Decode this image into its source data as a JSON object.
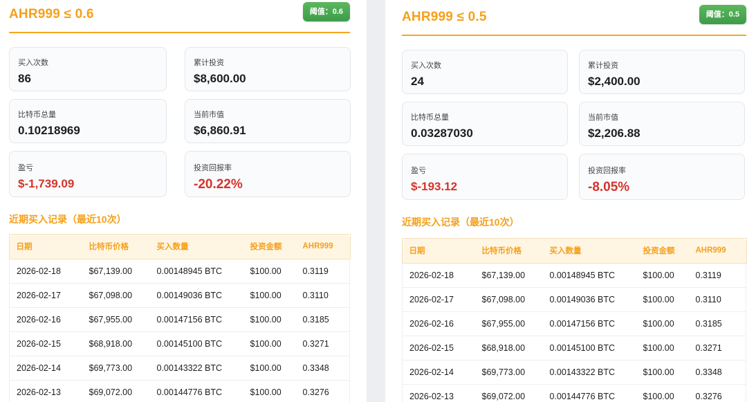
{
  "panels": [
    {
      "title": "AHR999 ≤ 0.6",
      "badge": "阈值：0.6",
      "stats": [
        {
          "label": "买入次数",
          "value": "86"
        },
        {
          "label": "累计投资",
          "value": "$8,600.00"
        },
        {
          "label": "比特币总量",
          "value": "0.10218969"
        },
        {
          "label": "当前市值",
          "value": "$6,860.91"
        },
        {
          "label": "盈亏",
          "value": "$-1,739.09"
        },
        {
          "label": "投资回报率",
          "value": "-20.22%"
        }
      ],
      "section_title": "近期买入记录（最近10次）",
      "table": {
        "headers": [
          "日期",
          "比特币价格",
          "买入数量",
          "投资金额",
          "AHR999"
        ],
        "rows": [
          [
            "2026-02-18",
            "$67,139.00",
            "0.00148945 BTC",
            "$100.00",
            "0.3119"
          ],
          [
            "2026-02-17",
            "$67,098.00",
            "0.00149036 BTC",
            "$100.00",
            "0.3110"
          ],
          [
            "2026-02-16",
            "$67,955.00",
            "0.00147156 BTC",
            "$100.00",
            "0.3185"
          ],
          [
            "2026-02-15",
            "$68,918.00",
            "0.00145100 BTC",
            "$100.00",
            "0.3271"
          ],
          [
            "2026-02-14",
            "$69,773.00",
            "0.00143322 BTC",
            "$100.00",
            "0.3348"
          ],
          [
            "2026-02-13",
            "$69,072.00",
            "0.00144776 BTC",
            "$100.00",
            "0.3276"
          ]
        ]
      }
    },
    {
      "title": "AHR999 ≤ 0.5",
      "badge": "阈值：0.5",
      "stats": [
        {
          "label": "买入次数",
          "value": "24"
        },
        {
          "label": "累计投资",
          "value": "$2,400.00"
        },
        {
          "label": "比特币总量",
          "value": "0.03287030"
        },
        {
          "label": "当前市值",
          "value": "$2,206.88"
        },
        {
          "label": "盈亏",
          "value": "$-193.12"
        },
        {
          "label": "投资回报率",
          "value": "-8.05%"
        }
      ],
      "section_title": "近期买入记录（最近10次）",
      "table": {
        "headers": [
          "日期",
          "比特币价格",
          "买入数量",
          "投资金额",
          "AHR999"
        ],
        "rows": [
          [
            "2026-02-18",
            "$67,139.00",
            "0.00148945 BTC",
            "$100.00",
            "0.3119"
          ],
          [
            "2026-02-17",
            "$67,098.00",
            "0.00149036 BTC",
            "$100.00",
            "0.3110"
          ],
          [
            "2026-02-16",
            "$67,955.00",
            "0.00147156 BTC",
            "$100.00",
            "0.3185"
          ],
          [
            "2026-02-15",
            "$68,918.00",
            "0.00145100 BTC",
            "$100.00",
            "0.3271"
          ],
          [
            "2026-02-14",
            "$69,773.00",
            "0.00143322 BTC",
            "$100.00",
            "0.3348"
          ],
          [
            "2026-02-13",
            "$69,072.00",
            "0.00144776 BTC",
            "$100.00",
            "0.3276"
          ]
        ]
      }
    }
  ],
  "colors": {
    "accent": "#f5a01a",
    "negative": "#d6332b",
    "badge": "#4caf50"
  }
}
